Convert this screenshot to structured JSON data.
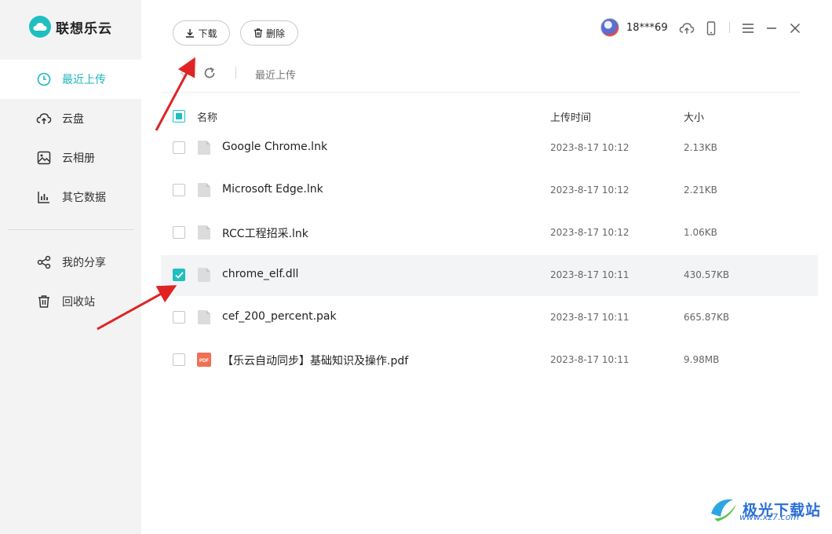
{
  "app": {
    "name": "联想乐云"
  },
  "sidebar": {
    "items": [
      {
        "label": "最近上传",
        "icon": "clock-icon",
        "active": true
      },
      {
        "label": "云盘",
        "icon": "cloud-upload-icon"
      },
      {
        "label": "云相册",
        "icon": "image-icon"
      },
      {
        "label": "其它数据",
        "icon": "bar-chart-icon"
      },
      {
        "label": "我的分享",
        "icon": "share-icon"
      },
      {
        "label": "回收站",
        "icon": "trash-icon"
      }
    ]
  },
  "toolbar": {
    "download_label": "下载",
    "delete_label": "删除"
  },
  "user": {
    "name": "18***69"
  },
  "breadcrumb": {
    "current": "最近上传"
  },
  "table": {
    "headers": {
      "name": "名称",
      "time": "上传时间",
      "size": "大小"
    },
    "rows": [
      {
        "name": "Google Chrome.lnk",
        "time": "2023-8-17 10:12",
        "size": "2.13KB",
        "type": "file",
        "checked": false
      },
      {
        "name": "Microsoft Edge.lnk",
        "time": "2023-8-17 10:12",
        "size": "2.21KB",
        "type": "file",
        "checked": false
      },
      {
        "name": "RCC工程招采.lnk",
        "time": "2023-8-17 10:12",
        "size": "1.06KB",
        "type": "file",
        "checked": false
      },
      {
        "name": "chrome_elf.dll",
        "time": "2023-8-17 10:11",
        "size": "430.57KB",
        "type": "file",
        "checked": true
      },
      {
        "name": "cef_200_percent.pak",
        "time": "2023-8-17 10:11",
        "size": "665.87KB",
        "type": "file",
        "checked": false
      },
      {
        "name": "【乐云自动同步】基础知识及操作.pdf",
        "time": "2023-8-17 10:11",
        "size": "9.98MB",
        "type": "pdf",
        "checked": false
      }
    ],
    "pdf_badge": "PDF"
  },
  "watermark": {
    "title": "极光下载站",
    "url": "www.xz7.com"
  },
  "colors": {
    "accent": "#1fbfc1",
    "arrow": "#e02424",
    "sidebar_bg": "#f3f3f3"
  }
}
